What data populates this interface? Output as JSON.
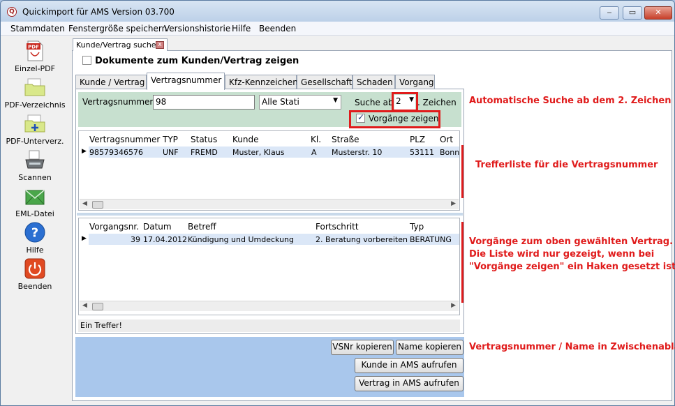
{
  "window": {
    "title": "Quickimport für AMS Version 03.700",
    "controls": {
      "minimize": "‒",
      "maximize": "▭",
      "close": "✕"
    }
  },
  "menu": [
    "Stammdaten",
    "Fenstergröße speichern",
    "Versionshistorie",
    "Hilfe",
    "Beenden"
  ],
  "sidebar": [
    {
      "label": "Einzel-PDF",
      "icon": "pdf-icon"
    },
    {
      "label": "PDF-Verzeichnis",
      "icon": "folder-icon"
    },
    {
      "label": "PDF-Unterverz.",
      "icon": "subfolder-icon"
    },
    {
      "label": "Scannen",
      "icon": "scanner-icon"
    },
    {
      "label": "EML-Datei",
      "icon": "email-icon"
    },
    {
      "label": "Hilfe",
      "icon": "help-icon"
    },
    {
      "label": "Beenden",
      "icon": "power-icon"
    }
  ],
  "doc_tab": {
    "label": "Kunde/Vertrag suchen",
    "close": "x"
  },
  "show_documents_label": "Dokumente zum Kunden/Vertrag zeigen",
  "tabs": [
    "Kunde / Vertrag",
    "Vertragsnummer",
    "Kfz-Kennzeichen",
    "Gesellschaft",
    "Schaden",
    "Vorgang"
  ],
  "active_tab": "Vertragsnummer",
  "search": {
    "label": "Vertragsnummer",
    "value": "98",
    "status_select": "Alle Stati",
    "search_from_label": "Suche ab",
    "search_from_value": "2",
    "chars_label": ". Zeichen",
    "show_processes_label": "Vorgänge zeigen",
    "show_processes_checked": true
  },
  "contracts_table": {
    "columns": [
      "Vertragsnummer",
      "TYP",
      "Status",
      "Kunde",
      "Kl.",
      "Straße",
      "PLZ",
      "Ort"
    ],
    "rows": [
      [
        "98579346576",
        "UNF",
        "FREMD",
        "Muster, Klaus",
        "A",
        "Musterstr. 10",
        "53111",
        "Bonn"
      ]
    ]
  },
  "processes_table": {
    "columns": [
      "Vorgangsnr.",
      "Datum",
      "Betreff",
      "Fortschritt",
      "Typ"
    ],
    "rows": [
      [
        "39",
        "17.04.2012",
        "Kündigung und Umdeckung",
        "2. Beratung vorbereiten",
        "BERATUNG"
      ]
    ]
  },
  "status_text": "Ein Treffer!",
  "buttons": {
    "copy_vsnr": "VSNr kopieren",
    "copy_name": "Name kopieren",
    "open_customer": "Kunde in AMS aufrufen",
    "open_contract": "Vertrag in AMS aufrufen"
  },
  "annotations": {
    "auto_search": "Automatische Suche ab dem 2. Zeichen",
    "hit_list": "Trefferliste für die Vertragsnummer",
    "processes_1": "Vorgänge zum oben gewählten Vertrag.",
    "processes_2": "Die Liste wird nur gezeigt, wenn bei",
    "processes_3": "\"Vorgänge zeigen\" ein Haken gesetzt ist.",
    "clipboard": "Vertragsnummer / Name in Zwischenablage"
  },
  "colors": {
    "annotation_red": "#e01b1b",
    "search_bg": "#c7e0cf",
    "button_bar_bg": "#a9c7ec"
  }
}
